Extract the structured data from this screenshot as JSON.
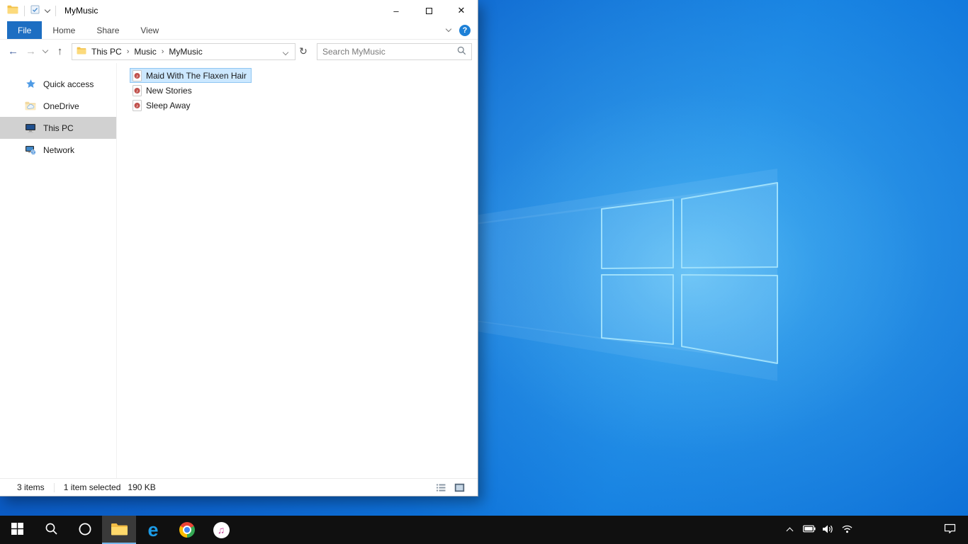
{
  "window": {
    "title": "MyMusic",
    "ribbon": {
      "file_tab": "File",
      "tabs": [
        "Home",
        "Share",
        "View"
      ],
      "help": "?"
    },
    "address": {
      "breadcrumbs": [
        "This PC",
        "Music",
        "MyMusic"
      ],
      "search_placeholder": "Search MyMusic"
    },
    "sidebar": {
      "items": [
        {
          "label": "Quick access",
          "icon": "star-icon"
        },
        {
          "label": "OneDrive",
          "icon": "onedrive-folder-icon"
        },
        {
          "label": "This PC",
          "icon": "computer-icon",
          "selected": true
        },
        {
          "label": "Network",
          "icon": "network-icon"
        }
      ]
    },
    "files": [
      {
        "name": "Maid With The Flaxen Hair",
        "icon": "music-file-icon",
        "selected": true
      },
      {
        "name": "New Stories",
        "icon": "music-file-icon",
        "selected": false
      },
      {
        "name": "Sleep Away",
        "icon": "music-file-icon",
        "selected": false
      }
    ],
    "status": {
      "count": "3 items",
      "selection": "1 item selected",
      "size": "190 KB"
    }
  },
  "glyphs": {
    "minimize": "–",
    "close": "✕",
    "back": "←",
    "forward": "→",
    "up": "↑",
    "refresh": "↻",
    "crumb_sep": "›"
  },
  "taskbar": {
    "buttons": [
      "start",
      "search",
      "cortana",
      "file-explorer",
      "edge",
      "chrome",
      "itunes"
    ],
    "active_button": "file-explorer",
    "tray_icons": [
      "chevron-up",
      "battery",
      "volume",
      "wifi"
    ],
    "action_center": "action-center"
  },
  "colors": {
    "file_tab_bg": "#1d6ec2",
    "help_bg": "#1d80d7",
    "selection_bg": "#cce8ff",
    "selection_border": "#8fc6f2",
    "sidebar_selected_bg": "#d1d1d1",
    "taskbar_bg": "#101010",
    "desktop_base": "#0d6ed4"
  }
}
